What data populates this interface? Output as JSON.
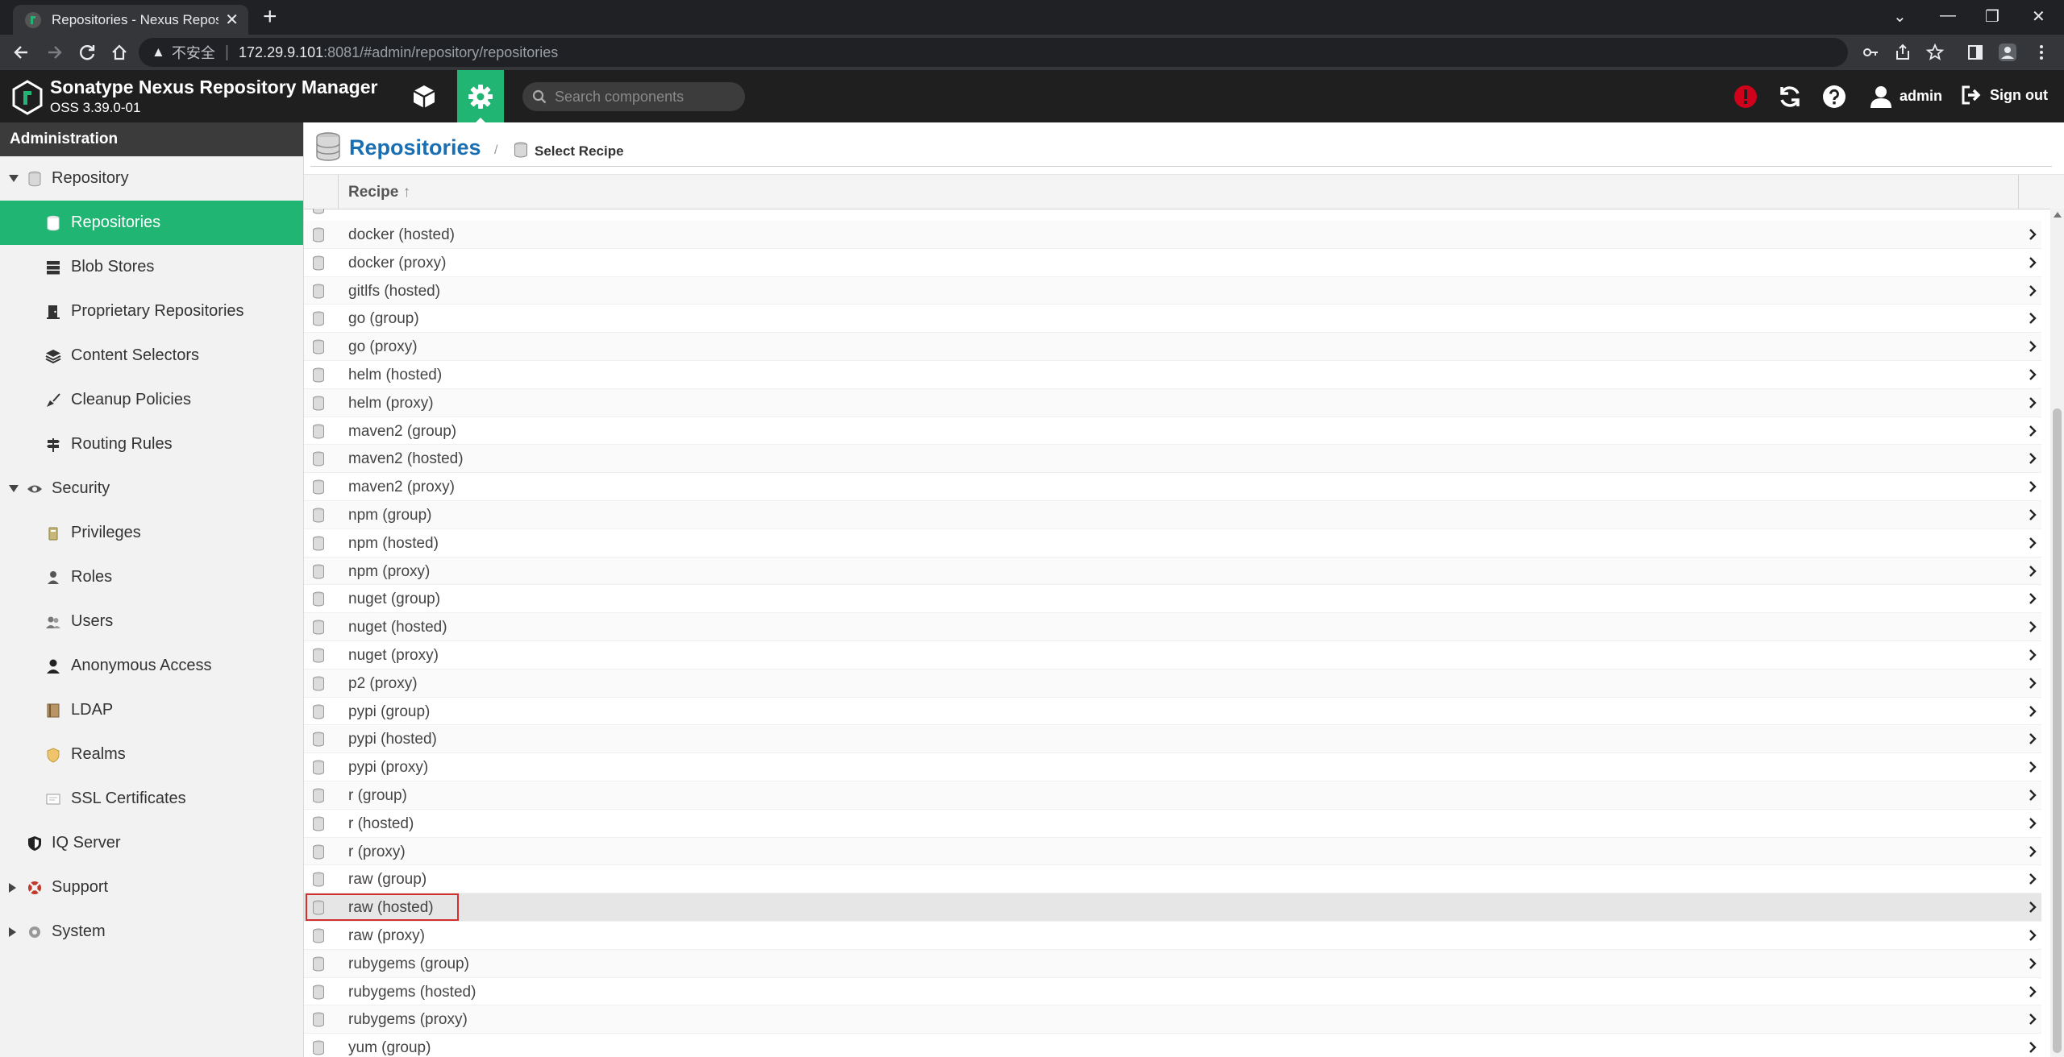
{
  "browser": {
    "tab_title": "Repositories - Nexus Repository Manager",
    "tab_close": "✕",
    "new_tab": "+",
    "omnibox": {
      "warning_icon": "warning-triangle-icon",
      "insecure_label": "不安全",
      "separator": "|",
      "url_host": "172.29.9.101",
      "url_rest": ":8081/#admin/repository/repositories"
    },
    "window_controls": [
      "⌄",
      "—",
      "❐",
      "✕"
    ]
  },
  "header": {
    "title": "Sonatype Nexus Repository Manager",
    "version": "OSS 3.39.0-01",
    "search_placeholder": "Search components",
    "user": "admin",
    "signout": "Sign out"
  },
  "sidebar": {
    "header": "Administration",
    "items": [
      {
        "label": "Repository",
        "level": 1,
        "icon": "database-icon",
        "expanded": true
      },
      {
        "label": "Repositories",
        "level": 2,
        "icon": "database-icon",
        "active": true
      },
      {
        "label": "Blob Stores",
        "level": 2,
        "icon": "server-icon"
      },
      {
        "label": "Proprietary Repositories",
        "level": 2,
        "icon": "door-icon"
      },
      {
        "label": "Content Selectors",
        "level": 2,
        "icon": "layers-icon"
      },
      {
        "label": "Cleanup Policies",
        "level": 2,
        "icon": "broom-icon"
      },
      {
        "label": "Routing Rules",
        "level": 2,
        "icon": "signpost-icon"
      },
      {
        "label": "Security",
        "level": 1,
        "icon": "eye-icon",
        "expanded": true
      },
      {
        "label": "Privileges",
        "level": 2,
        "icon": "badge-icon"
      },
      {
        "label": "Roles",
        "level": 2,
        "icon": "role-icon"
      },
      {
        "label": "Users",
        "level": 2,
        "icon": "users-icon"
      },
      {
        "label": "Anonymous Access",
        "level": 2,
        "icon": "person-icon"
      },
      {
        "label": "LDAP",
        "level": 2,
        "icon": "book-icon"
      },
      {
        "label": "Realms",
        "level": 2,
        "icon": "shield-icon"
      },
      {
        "label": "SSL Certificates",
        "level": 2,
        "icon": "certificate-icon"
      },
      {
        "label": "IQ Server",
        "level": 1,
        "icon": "iq-shield-icon"
      },
      {
        "label": "Support",
        "level": 1,
        "icon": "lifebuoy-icon",
        "collapsed": true
      },
      {
        "label": "System",
        "level": 1,
        "icon": "gear-icon",
        "collapsed": true
      }
    ]
  },
  "main": {
    "title": "Repositories",
    "breadcrumb_sep": "/",
    "breadcrumb": "Select Recipe",
    "column_header": "Recipe",
    "sort_indicator": "↑",
    "recipes": [
      "docker (hosted)",
      "docker (proxy)",
      "gitlfs (hosted)",
      "go (group)",
      "go (proxy)",
      "helm (hosted)",
      "helm (proxy)",
      "maven2 (group)",
      "maven2 (hosted)",
      "maven2 (proxy)",
      "npm (group)",
      "npm (hosted)",
      "npm (proxy)",
      "nuget (group)",
      "nuget (hosted)",
      "nuget (proxy)",
      "p2 (proxy)",
      "pypi (group)",
      "pypi (hosted)",
      "pypi (proxy)",
      "r (group)",
      "r (hosted)",
      "r (proxy)",
      "raw (group)",
      "raw (hosted)",
      "raw (proxy)",
      "rubygems (group)",
      "rubygems (hosted)",
      "rubygems (proxy)",
      "yum (group)"
    ],
    "selected_recipe": "raw (hosted)"
  },
  "colors": {
    "accent": "#21b573",
    "title_blue": "#1a6fb3",
    "header_bg": "#1f1f1f",
    "highlight": "#d32f2f"
  }
}
